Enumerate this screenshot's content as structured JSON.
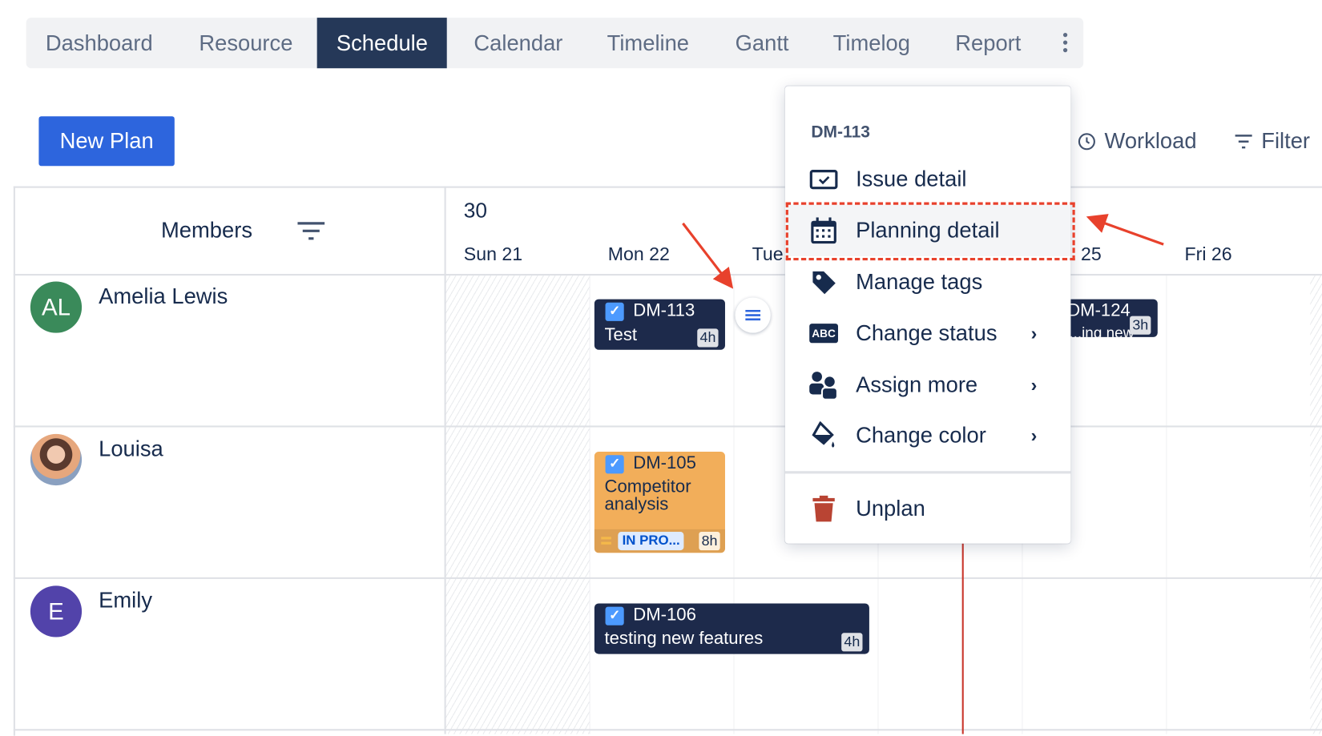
{
  "tabs": [
    {
      "label": "Dashboard"
    },
    {
      "label": "Resource"
    },
    {
      "label": "Schedule",
      "active": true
    },
    {
      "label": "Calendar"
    },
    {
      "label": "Timeline"
    },
    {
      "label": "Gantt"
    },
    {
      "label": "Timelog"
    },
    {
      "label": "Report"
    }
  ],
  "toolbar": {
    "new_plan": "New Plan",
    "workload": "Workload",
    "filter": "Filter"
  },
  "grid": {
    "members_header": "Members",
    "week": "30",
    "days": [
      "Sun 21",
      "Mon 22",
      "Tue",
      "25",
      "Fri 26"
    ]
  },
  "members": [
    {
      "name": "Amelia Lewis",
      "initials": "AL",
      "color": "#3a8a5a"
    },
    {
      "name": "Louisa",
      "initials": "",
      "color": "#c9a08a"
    },
    {
      "name": "Emily",
      "initials": "E",
      "color": "#5243aa"
    }
  ],
  "cards": [
    {
      "key": "DM-113",
      "summary": "Test",
      "hours": "4h",
      "color": "#1d2a4b"
    },
    {
      "key": "DM-124",
      "summary": "...ing new",
      "hours": "3h",
      "color": "#1d2a4b"
    },
    {
      "key": "DM-105",
      "summary": "Competitor analysis",
      "status": "IN PRO...",
      "hours": "8h",
      "color": "#f2ae5a"
    },
    {
      "key": "DM-106",
      "summary": "testing new features",
      "hours": "4h",
      "color": "#1d2a4b"
    }
  ],
  "context_menu": {
    "title": "DM-113",
    "items": [
      {
        "label": "Issue detail",
        "icon": "issue-check-icon"
      },
      {
        "label": "Planning detail",
        "icon": "calendar-icon",
        "highlighted": true
      },
      {
        "label": "Manage tags",
        "icon": "tag-icon"
      },
      {
        "label": "Change status",
        "icon": "abc-icon",
        "submenu": true
      },
      {
        "label": "Assign more",
        "icon": "people-icon",
        "submenu": true
      },
      {
        "label": "Change color",
        "icon": "paint-bucket-icon",
        "submenu": true
      },
      {
        "label": "Unplan",
        "icon": "trash-icon"
      }
    ],
    "abc": "ABC"
  },
  "colors": {
    "accent": "#2d65dd",
    "active_tab": "#253858",
    "annotation": "#e8412c",
    "today_line": "#c9372c"
  }
}
